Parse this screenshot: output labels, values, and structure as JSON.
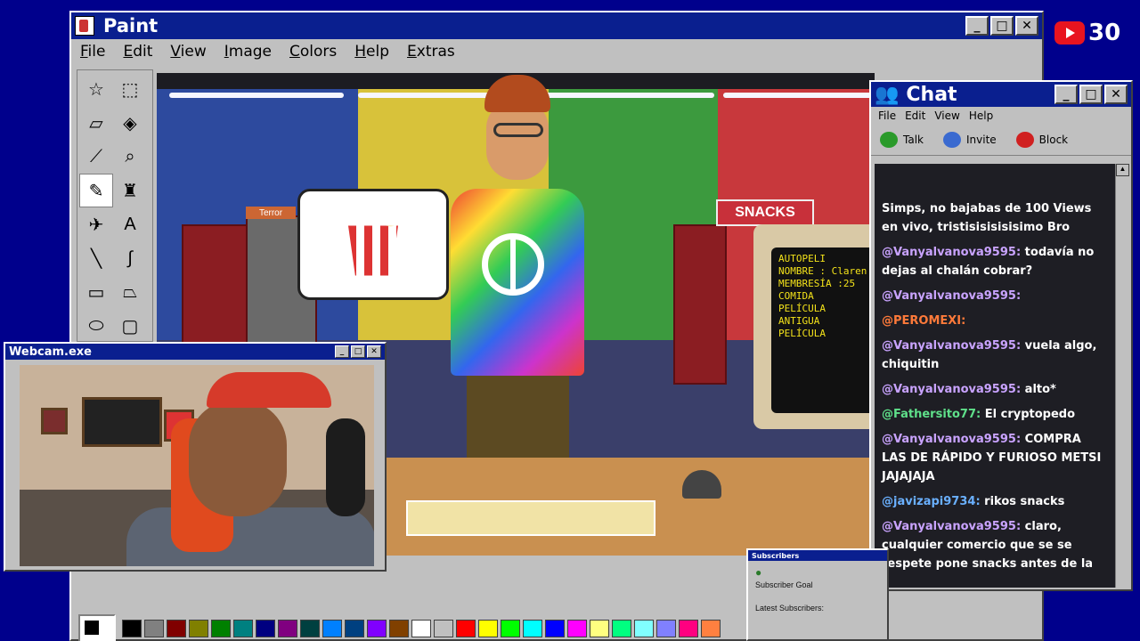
{
  "paint": {
    "title": "Paint",
    "menu": [
      "File",
      "Edit",
      "View",
      "Image",
      "Colors",
      "Help",
      "Extras"
    ],
    "tools": [
      "free-select",
      "rect-select",
      "eraser",
      "fill",
      "color-picker",
      "magnifier",
      "pencil",
      "brush",
      "airbrush",
      "text",
      "line",
      "curve",
      "rectangle",
      "polygon",
      "ellipse",
      "rounded-rect"
    ],
    "palette": [
      "#000000",
      "#808080",
      "#800000",
      "#808000",
      "#008000",
      "#008080",
      "#000080",
      "#800080",
      "#004040",
      "#0080ff",
      "#004080",
      "#8000ff",
      "#804000",
      "#ffffff",
      "#c0c0c0",
      "#ff0000",
      "#ffff00",
      "#00ff00",
      "#00ffff",
      "#0000ff",
      "#ff00ff",
      "#ffff80",
      "#00ff80",
      "#80ffff",
      "#8080ff",
      "#ff0080",
      "#ff8040"
    ]
  },
  "scene": {
    "snacks_sign": "SNACKS",
    "terror_sign": "Terror",
    "screen_lines": [
      "AUTOPELI",
      "NOMBRE : Claren",
      "MEMBRESÍA :25",
      "COMIDA",
      "",
      "PELÍCULA",
      "ANTIGUA",
      "",
      "PELÍCULA"
    ]
  },
  "webcam": {
    "title": "Webcam.exe"
  },
  "chat": {
    "title": "Chat",
    "menu": [
      "File",
      "Edit",
      "View",
      "Help"
    ],
    "tools": [
      {
        "label": "Talk",
        "icon": "talk-icon",
        "color": "#2a9a2a"
      },
      {
        "label": "Invite",
        "icon": "invite-icon",
        "color": "#3a6ad0"
      },
      {
        "label": "Block",
        "icon": "block-icon",
        "color": "#d02020"
      }
    ],
    "messages": [
      {
        "user": "",
        "text": "Simps, no bajabas de 100 Views en vivo, tristisisisisisimo Bro",
        "color": "#ffffff"
      },
      {
        "user": "@Vanyalvanova9595:",
        "text": "todavía no dejas al chalán cobrar?",
        "color": "#c9a3ff"
      },
      {
        "user": "@Vanyalvanova9595:",
        "text": "",
        "color": "#c9a3ff"
      },
      {
        "user": "@PEROMEXI:",
        "text": "",
        "color": "#ff7a3a"
      },
      {
        "user": "@Vanyalvanova9595:",
        "text": "vuela algo, chiquitin",
        "color": "#c9a3ff"
      },
      {
        "user": "@Vanyalvanova9595:",
        "text": "alto*",
        "color": "#c9a3ff"
      },
      {
        "user": "@Fathersito77:",
        "text": "El cryptopedo",
        "color": "#5fe08a"
      },
      {
        "user": "@Vanyalvanova9595:",
        "text": "COMPRA LAS DE RÁPIDO Y FURIOSO METSI JAJAJAJA",
        "color": "#c9a3ff"
      },
      {
        "user": "@javizapi9734:",
        "text": "rikos snacks",
        "color": "#6ab0ff"
      },
      {
        "user": "@Vanyalvanova9595:",
        "text": "claro, cualquier comercio que se se respete pone snacks antes de la",
        "color": "#c9a3ff"
      }
    ]
  },
  "subscribers": {
    "title": "Subscribers",
    "goal_label": "Subscriber Goal",
    "latest_label": "Latest Subscribers:"
  },
  "youtube": {
    "count": "30",
    "accent": "#e8141f"
  }
}
